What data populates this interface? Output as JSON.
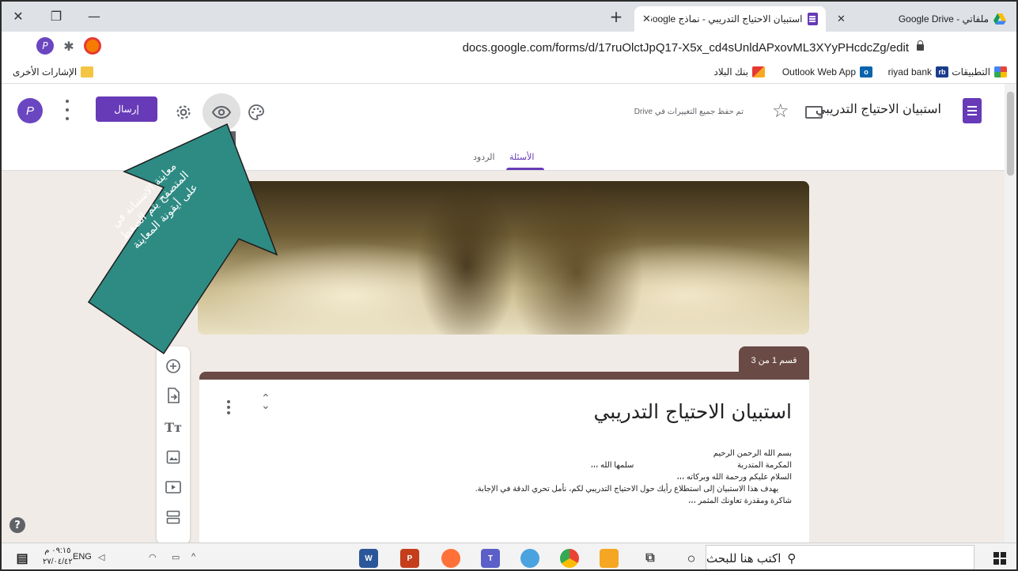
{
  "window": {
    "close_glyph": "✕",
    "restore_glyph": "❐",
    "minimize_glyph": "—"
  },
  "tabs": [
    {
      "title": "ملفاتي - Google Drive",
      "close": "✕",
      "icon": "google-drive-icon"
    },
    {
      "title": "استبيان الاحتياج التدريبي - نماذج Google",
      "close": "✕",
      "icon": "google-forms-icon"
    }
  ],
  "new_tab_glyph": "+",
  "address": {
    "url": "docs.google.com/forms/d/17ruOlctJpQ17-X5x_cd4sUnldAPxovML3XYyPHcdcZg/edit",
    "star_glyph": "☆"
  },
  "bookmarks": {
    "apps": "التطبيقات",
    "riyad": "riyad bank",
    "outlook": "Outlook Web App",
    "albilad": "بنك البلاد",
    "other": "الإشارات الأخرى"
  },
  "forms_header": {
    "title": "استبيان الاحتياج التدريبي",
    "saved_status": "تم حفظ جميع التغييرات في Drive",
    "send_label": "إرسال",
    "avatar_letter": "P",
    "tab_questions": "الأسئلة",
    "tab_responses": "الردود"
  },
  "section_label": "قسم 1 من 3",
  "form_card": {
    "title": "استبيان الاحتياج التدريبي",
    "description": "بسم الله الرحمن الرحيم\nالمكرمة المتدربة                                               سلمها الله ،،،\nالسلام عليكم ورحمة الله وبركاته ،،،\n      يهدف هذا الاستبيان إلى استطلاع رأيك حول الاحتياج التدريبي لكم، نأمل تحري الدقة في الإجابة.\nشاكرة ومقدرة تعاونك المثمر ،،،"
  },
  "annotation": {
    "text": "معاينة الاستبانة في المتصفح يتم الضغط على أيقونة المعاينة",
    "color": "#2e8b83"
  },
  "help_glyph": "?",
  "taskbar": {
    "search_placeholder": "اكتب هنا للبحث",
    "lang": "ENG",
    "time": "٠٩:١٥ م",
    "date": "٢٧/٠٤/٤٢"
  },
  "colors": {
    "forms_purple": "#673ab7",
    "section_brown": "#6a4a45",
    "canvas_bg": "#f1ebe7"
  }
}
